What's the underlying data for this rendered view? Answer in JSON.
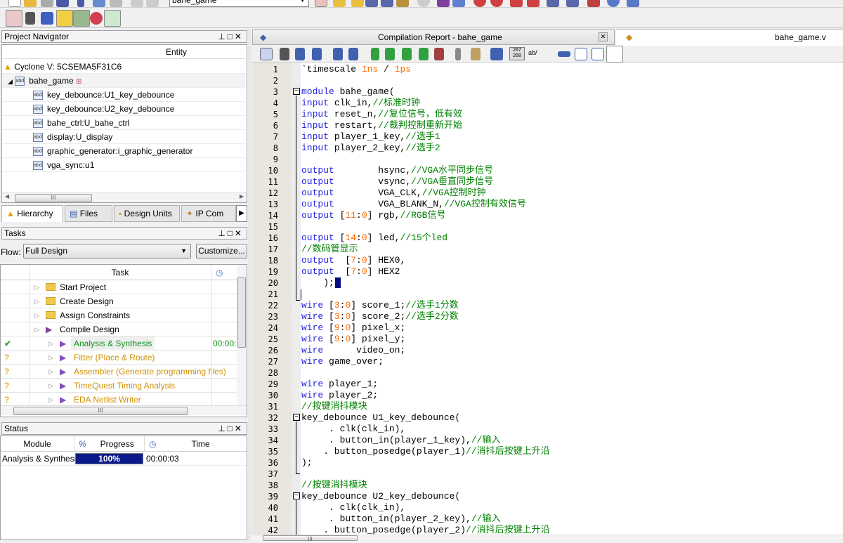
{
  "toolbar": {
    "project_select": "bahe_game"
  },
  "navigator": {
    "title": "Project Navigator",
    "entity_header": "Entity",
    "device": "Cyclone V: 5CSEMA5F31C6",
    "top": "bahe_game",
    "children": [
      "key_debounce:U1_key_debounce",
      "key_debounce:U2_key_debounce",
      "bahe_ctrl:U_bahe_ctrl",
      "display:U_display",
      "graphic_generator:i_graphic_generator",
      "vga_sync:u1"
    ],
    "tabs": [
      "Hierarchy",
      "Files",
      "Design Units",
      "IP Com"
    ]
  },
  "tasks": {
    "title": "Tasks",
    "flow_label": "Flow:",
    "flow_value": "Full Design",
    "customize": "Customize...",
    "header_task": "Task",
    "rows": [
      {
        "label": "Start Project",
        "status": "",
        "time": "",
        "level": 1,
        "kind": "folder"
      },
      {
        "label": "Create Design",
        "status": "",
        "time": "",
        "level": 1,
        "kind": "folder"
      },
      {
        "label": "Assign Constraints",
        "status": "",
        "time": "",
        "level": 1,
        "kind": "folder"
      },
      {
        "label": "Compile Design",
        "status": "",
        "time": "",
        "level": 1,
        "kind": "play"
      },
      {
        "label": "Analysis & Synthesis",
        "status": "done",
        "time": "00:00:",
        "level": 2,
        "kind": "play"
      },
      {
        "label": "Fitter (Place & Route)",
        "status": "pending",
        "time": "",
        "level": 2,
        "kind": "play"
      },
      {
        "label": "Assembler (Generate programming files)",
        "status": "pending",
        "time": "",
        "level": 2,
        "kind": "play"
      },
      {
        "label": "TimeQuest Timing Analysis",
        "status": "pending",
        "time": "",
        "level": 2,
        "kind": "play"
      },
      {
        "label": "EDA Netlist Writer",
        "status": "pending",
        "time": "",
        "level": 2,
        "kind": "play"
      }
    ],
    "status_glyphs": {
      "done": "✔",
      "pending": "?"
    }
  },
  "status": {
    "title": "Status",
    "headers": {
      "module": "Module",
      "pct": "%",
      "progress": "Progress",
      "time": "Time"
    },
    "row": {
      "module": "Analysis & Synthesis",
      "progress_pct": 100,
      "progress_label": "100%",
      "time": "00:00:03"
    }
  },
  "editor": {
    "tabs": {
      "report": "Compilation Report - bahe_game",
      "file": "bahe_game.v"
    },
    "toolbar_text": {
      "linenum": "267\n268",
      "ab": "ab/"
    },
    "colors": {
      "keyword": "#2424e0",
      "number": "#ff6a00",
      "comment": "#008000"
    },
    "lines": [
      [
        [
          "t",
          "`timescale "
        ],
        [
          "n",
          "1ns"
        ],
        [
          "t",
          " / "
        ],
        [
          "n",
          "1ps"
        ]
      ],
      [],
      [
        [
          "k",
          "module"
        ],
        [
          "t",
          " bahe_game("
        ]
      ],
      [
        [
          "k",
          "input"
        ],
        [
          "t",
          " clk_in,"
        ],
        [
          "c",
          "//标准时钟"
        ]
      ],
      [
        [
          "k",
          "input"
        ],
        [
          "t",
          " reset_n,"
        ],
        [
          "c",
          "//复位信号，低有效"
        ]
      ],
      [
        [
          "k",
          "input"
        ],
        [
          "t",
          " restart,"
        ],
        [
          "c",
          "//裁判控制重新开始"
        ]
      ],
      [
        [
          "k",
          "input"
        ],
        [
          "t",
          " player_1_key,"
        ],
        [
          "c",
          "//选手1"
        ]
      ],
      [
        [
          "k",
          "input"
        ],
        [
          "t",
          " player_2_key,"
        ],
        [
          "c",
          "//选手2"
        ]
      ],
      [],
      [
        [
          "k",
          "output"
        ],
        [
          "t",
          "        hsync,"
        ],
        [
          "c",
          "//VGA水平同步信号"
        ]
      ],
      [
        [
          "k",
          "output"
        ],
        [
          "t",
          "        vsync,"
        ],
        [
          "c",
          "//VGA垂直同步信号"
        ]
      ],
      [
        [
          "k",
          "output"
        ],
        [
          "t",
          "        VGA_CLK,"
        ],
        [
          "c",
          "//VGA控制时钟"
        ]
      ],
      [
        [
          "k",
          "output"
        ],
        [
          "t",
          "        VGA_BLANK_N,"
        ],
        [
          "c",
          "//VGA控制有效信号"
        ]
      ],
      [
        [
          "k",
          "output"
        ],
        [
          "t",
          " ["
        ],
        [
          "n",
          "11"
        ],
        [
          "t",
          ":"
        ],
        [
          "n",
          "0"
        ],
        [
          "t",
          "] rgb,"
        ],
        [
          "c",
          "//RGB信号"
        ]
      ],
      [],
      [
        [
          "k",
          "output"
        ],
        [
          "t",
          " ["
        ],
        [
          "n",
          "14"
        ],
        [
          "t",
          ":"
        ],
        [
          "n",
          "0"
        ],
        [
          "t",
          "] led,"
        ],
        [
          "c",
          "//15个led"
        ]
      ],
      [
        [
          "c",
          "//数码管显示"
        ]
      ],
      [
        [
          "k",
          "output"
        ],
        [
          "t",
          "  ["
        ],
        [
          "n",
          "7"
        ],
        [
          "t",
          ":"
        ],
        [
          "n",
          "0"
        ],
        [
          "t",
          "] HEX0,"
        ]
      ],
      [
        [
          "k",
          "output"
        ],
        [
          "t",
          "  ["
        ],
        [
          "n",
          "7"
        ],
        [
          "t",
          ":"
        ],
        [
          "n",
          "0"
        ],
        [
          "t",
          "] HEX2"
        ]
      ],
      [
        [
          "t",
          "    );"
        ]
      ],
      [],
      [
        [
          "k",
          "wire"
        ],
        [
          "t",
          " ["
        ],
        [
          "n",
          "3"
        ],
        [
          "t",
          ":"
        ],
        [
          "n",
          "0"
        ],
        [
          "t",
          "] score_1;"
        ],
        [
          "c",
          "//选手1分数"
        ]
      ],
      [
        [
          "k",
          "wire"
        ],
        [
          "t",
          " ["
        ],
        [
          "n",
          "3"
        ],
        [
          "t",
          ":"
        ],
        [
          "n",
          "0"
        ],
        [
          "t",
          "] score_2;"
        ],
        [
          "c",
          "//选手2分数"
        ]
      ],
      [
        [
          "k",
          "wire"
        ],
        [
          "t",
          " ["
        ],
        [
          "n",
          "9"
        ],
        [
          "t",
          ":"
        ],
        [
          "n",
          "0"
        ],
        [
          "t",
          "] pixel_x;"
        ]
      ],
      [
        [
          "k",
          "wire"
        ],
        [
          "t",
          " ["
        ],
        [
          "n",
          "9"
        ],
        [
          "t",
          ":"
        ],
        [
          "n",
          "0"
        ],
        [
          "t",
          "] pixel_y;"
        ]
      ],
      [
        [
          "k",
          "wire"
        ],
        [
          "t",
          "      video_on;"
        ]
      ],
      [
        [
          "k",
          "wire"
        ],
        [
          "t",
          " game_over;"
        ]
      ],
      [],
      [
        [
          "k",
          "wire"
        ],
        [
          "t",
          " player_1;"
        ]
      ],
      [
        [
          "k",
          "wire"
        ],
        [
          "t",
          " player_2;"
        ]
      ],
      [
        [
          "c",
          "//按键消抖模块"
        ]
      ],
      [
        [
          "t",
          "key_debounce U1_key_debounce("
        ]
      ],
      [
        [
          "t",
          "     . clk(clk_in),"
        ]
      ],
      [
        [
          "t",
          "     . button_in(player_1_key),"
        ],
        [
          "c",
          "//输入"
        ]
      ],
      [
        [
          "t",
          "    . button_posedge(player_1)"
        ],
        [
          "c",
          "//消抖后按键上升沿"
        ]
      ],
      [
        [
          "t",
          "); "
        ]
      ],
      [],
      [
        [
          "c",
          "//按键消抖模块"
        ]
      ],
      [
        [
          "t",
          "key_debounce U2_key_debounce("
        ]
      ],
      [
        [
          "t",
          "     . clk(clk_in),"
        ]
      ],
      [
        [
          "t",
          "     . button_in(player_2_key),"
        ],
        [
          "c",
          "//输入"
        ]
      ],
      [
        [
          "t",
          "    . button_posedge(player_2)"
        ],
        [
          "c",
          "//消抖后按键上升沿"
        ]
      ]
    ]
  }
}
